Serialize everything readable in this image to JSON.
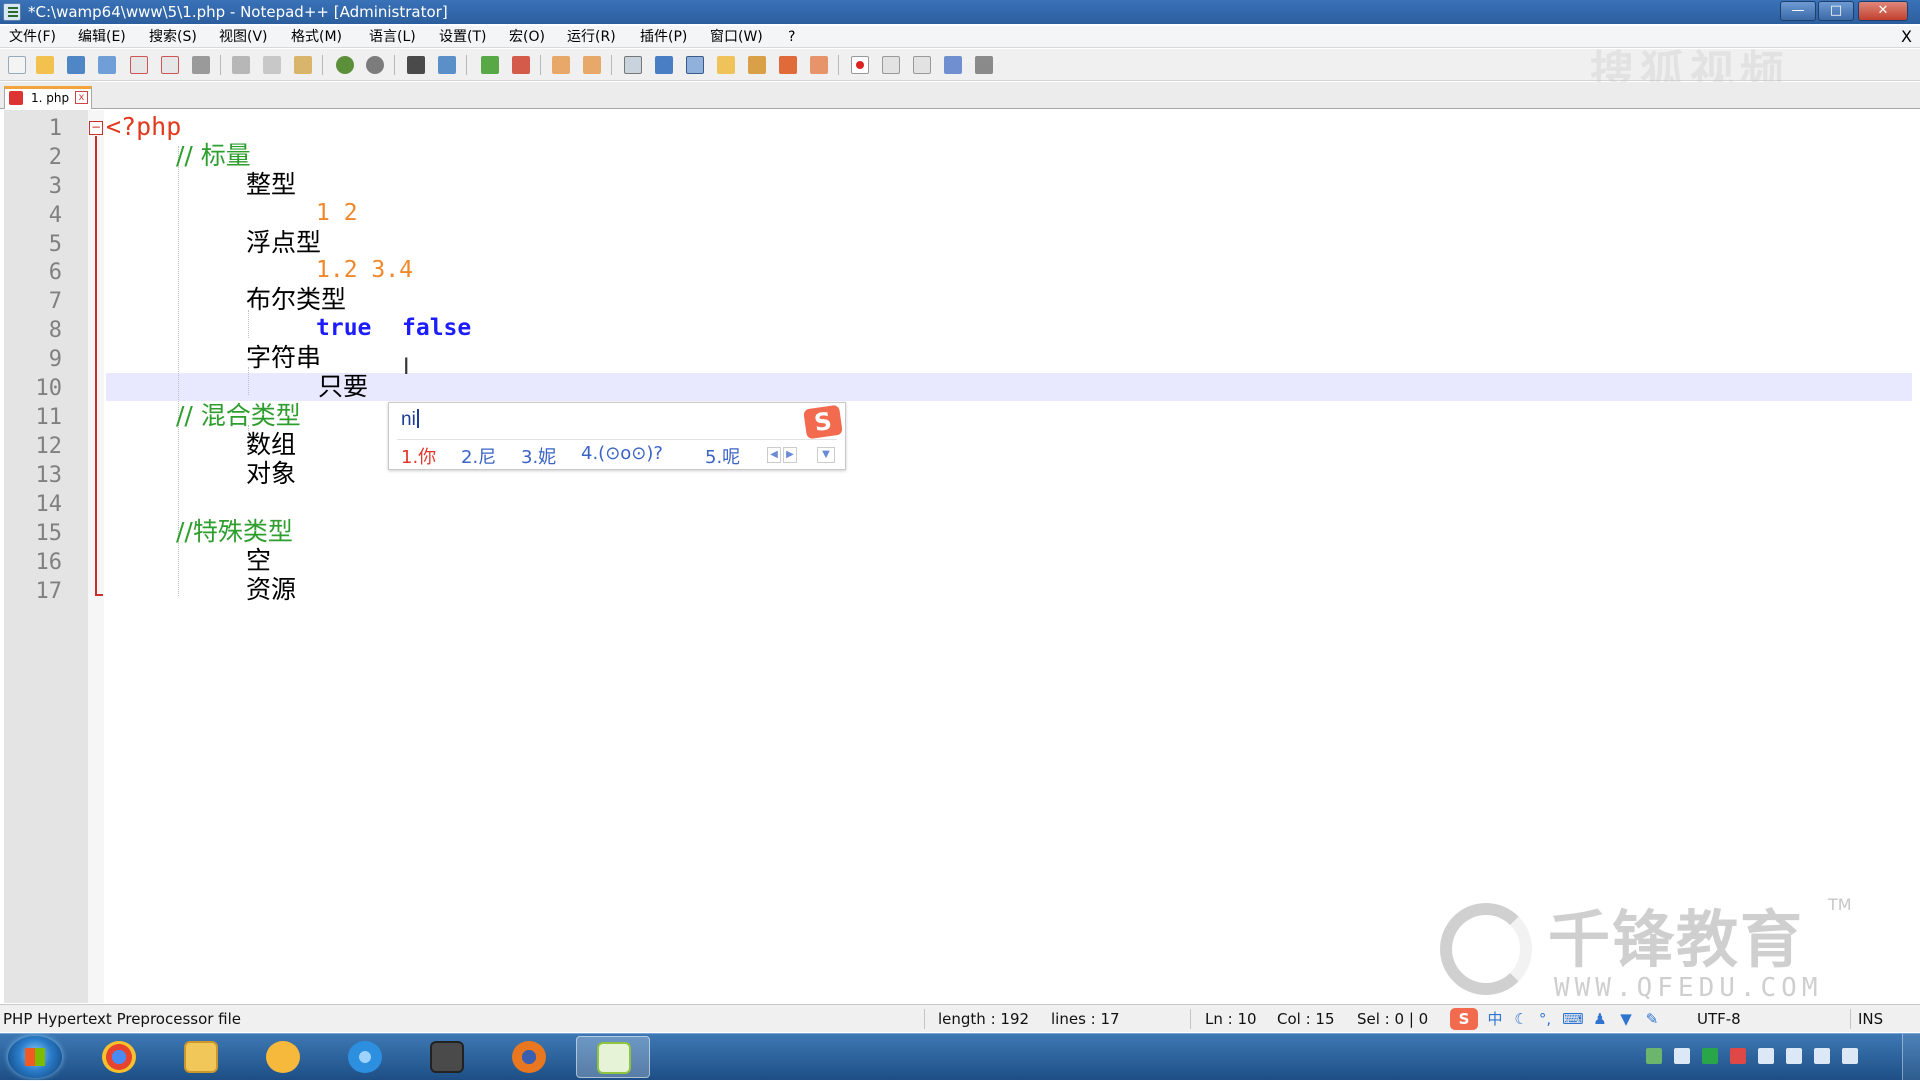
{
  "window": {
    "title": "*C:\\wamp64\\www\\5\\1.php - Notepad++ [Administrator]",
    "minimize_glyph": "—",
    "maximize_glyph": "□",
    "close_glyph": "✕"
  },
  "menu": {
    "items": [
      "文件(F)",
      "编辑(E)",
      "搜索(S)",
      "视图(V)",
      "格式(M)",
      "语言(L)",
      "设置(T)",
      "宏(O)",
      "运行(R)",
      "插件(P)",
      "窗口(W)",
      "?"
    ],
    "close_doc": "X"
  },
  "toolbar": {
    "icons": [
      "new-file-icon",
      "open-file-icon",
      "save-icon",
      "save-all-icon",
      "close-icon",
      "close-all-icon",
      "print-icon",
      "cut-icon",
      "copy-icon",
      "paste-icon",
      "undo-icon",
      "redo-icon",
      "find-icon",
      "replace-icon",
      "zoom-in-icon",
      "zoom-out-icon",
      "sync-v-icon",
      "sync-h-icon",
      "word-wrap-icon",
      "show-all-chars-icon",
      "indent-guide-icon",
      "udl-icon",
      "doc-map-icon",
      "function-list-icon",
      "folder-workspace-icon",
      "record-macro-icon",
      "stop-record-icon",
      "play-macro-icon",
      "run-macro-multiple-icon",
      "save-macro-icon"
    ],
    "watermark": "搜狐视频"
  },
  "tabs": [
    {
      "label": "1. php",
      "close": "x"
    }
  ],
  "editor": {
    "fold_marker": "−",
    "lines": [
      {
        "no": "1",
        "segments": [
          {
            "text": "<?php",
            "type": "tag"
          }
        ]
      },
      {
        "no": "2",
        "segments": [
          {
            "text": "// 标量",
            "type": "comment"
          }
        ]
      },
      {
        "no": "3",
        "segments": [
          {
            "text": "整型",
            "type": "plain"
          }
        ]
      },
      {
        "no": "4",
        "segments": [
          {
            "text": "1 2",
            "type": "num"
          }
        ]
      },
      {
        "no": "5",
        "segments": [
          {
            "text": "浮点型",
            "type": "plain"
          }
        ]
      },
      {
        "no": "6",
        "segments": [
          {
            "text": "1.2 3.4",
            "type": "num"
          }
        ]
      },
      {
        "no": "7",
        "segments": [
          {
            "text": "布尔类型",
            "type": "plain"
          }
        ]
      },
      {
        "no": "8",
        "segments": [
          {
            "text": "true",
            "type": "kw"
          },
          {
            "text": "false",
            "type": "kw"
          }
        ]
      },
      {
        "no": "9",
        "segments": [
          {
            "text": "字符串",
            "type": "plain"
          }
        ]
      },
      {
        "no": "10",
        "segments": [
          {
            "text": "只要",
            "type": "plain"
          }
        ]
      },
      {
        "no": "11",
        "segments": [
          {
            "text": "// 混合类型",
            "type": "comment"
          }
        ]
      },
      {
        "no": "12",
        "segments": [
          {
            "text": "数组",
            "type": "plain"
          }
        ]
      },
      {
        "no": "13",
        "segments": [
          {
            "text": "对象",
            "type": "plain"
          }
        ]
      },
      {
        "no": "14",
        "segments": []
      },
      {
        "no": "15",
        "segments": [
          {
            "text": "//特殊类型",
            "type": "comment"
          }
        ]
      },
      {
        "no": "16",
        "segments": [
          {
            "text": "空",
            "type": "plain"
          }
        ]
      },
      {
        "no": "17",
        "segments": [
          {
            "text": "资源",
            "type": "plain"
          }
        ]
      }
    ],
    "current_line": "10",
    "mouse_cursor": "I"
  },
  "ime_popup": {
    "input": "ni",
    "logo": "S",
    "candidates": [
      "1.你",
      "2.尼",
      "3.妮",
      "4.(⊙o⊙)?",
      "5.呢"
    ],
    "prev": "◀",
    "next": "▶",
    "more": "▼"
  },
  "watermark": {
    "main": "千锋教育",
    "url": "WWW.QFEDU.COM",
    "tm": "TM"
  },
  "status": {
    "file_type": "PHP Hypertext Preprocessor file",
    "length": "length : 192",
    "lines": "lines : 17",
    "ln": "Ln : 10",
    "col": "Col : 15",
    "sel": "Sel : 0 | 0",
    "ime_logo": "S",
    "ime_mode": "中",
    "ime_icons": [
      "moon-icon",
      "punctuation-icon",
      "keyboard-icon",
      "user-icon",
      "shirt-icon",
      "wrench-icon"
    ],
    "encoding": "UTF-8",
    "insert_mode": "INS"
  },
  "taskbar": {
    "apps": [
      {
        "name": "chrome",
        "color": "#e6442e"
      },
      {
        "name": "explorer",
        "color": "#f1c75a"
      },
      {
        "name": "qq-pet",
        "color": "#f6b93b"
      },
      {
        "name": "internet-explorer",
        "color": "#2d8fe0"
      },
      {
        "name": "sublime-text",
        "color": "#4a4a4a"
      },
      {
        "name": "firefox",
        "color": "#e8771f"
      },
      {
        "name": "notepad-plus-plus",
        "color": "#8fc440"
      }
    ],
    "tray_icons": [
      "network-shield-icon",
      "keyboard-tray-icon",
      "green-app-icon",
      "flag-icon",
      "battery-icon",
      "monitor-icon",
      "volume-icon",
      "message-icon"
    ]
  }
}
